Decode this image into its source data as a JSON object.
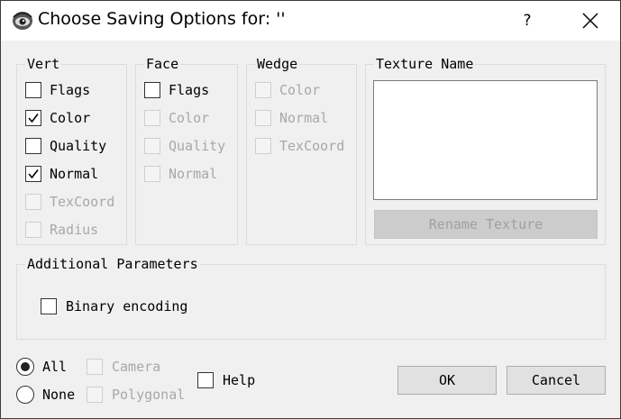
{
  "window": {
    "title": "Choose Saving Options for: ''",
    "help_label": "?"
  },
  "vert": {
    "label": "Vert",
    "items": [
      {
        "label": "Flags",
        "checked": false,
        "enabled": true
      },
      {
        "label": "Color",
        "checked": true,
        "enabled": true
      },
      {
        "label": "Quality",
        "checked": false,
        "enabled": true
      },
      {
        "label": "Normal",
        "checked": true,
        "enabled": true
      },
      {
        "label": "TexCoord",
        "checked": false,
        "enabled": false
      },
      {
        "label": "Radius",
        "checked": false,
        "enabled": false
      }
    ]
  },
  "face": {
    "label": "Face",
    "items": [
      {
        "label": "Flags",
        "checked": false,
        "enabled": true
      },
      {
        "label": "Color",
        "checked": false,
        "enabled": false
      },
      {
        "label": "Quality",
        "checked": false,
        "enabled": false
      },
      {
        "label": "Normal",
        "checked": false,
        "enabled": false
      }
    ]
  },
  "wedge": {
    "label": "Wedge",
    "items": [
      {
        "label": "Color",
        "checked": false,
        "enabled": false
      },
      {
        "label": "Normal",
        "checked": false,
        "enabled": false
      },
      {
        "label": "TexCoord",
        "checked": false,
        "enabled": false
      }
    ]
  },
  "texture": {
    "label": "Texture Name",
    "rename_label": "Rename Texture"
  },
  "additional": {
    "label": "Additional Parameters",
    "binary_label": "Binary encoding",
    "binary_checked": false
  },
  "selection": {
    "all_label": "All",
    "all_selected": true,
    "none_label": "None",
    "none_selected": false,
    "camera_label": "Camera",
    "polygonal_label": "Polygonal",
    "help_label": "Help"
  },
  "buttons": {
    "ok_label": "OK",
    "cancel_label": "Cancel"
  }
}
